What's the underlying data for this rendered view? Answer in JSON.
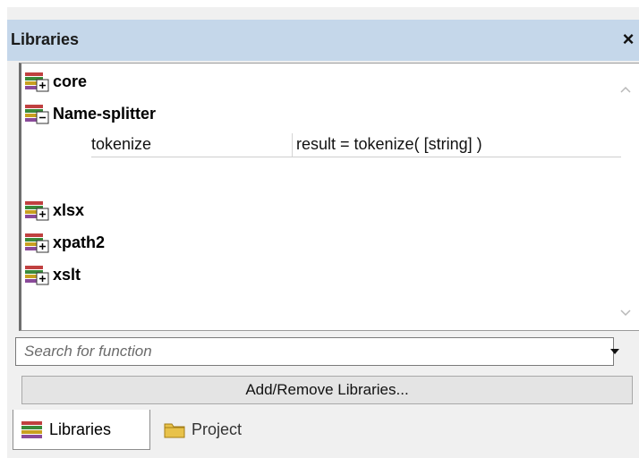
{
  "panel": {
    "title": "Libraries",
    "close_glyph": "×",
    "close_icon": "close-icon"
  },
  "tree": {
    "libraries": [
      {
        "name": "core",
        "state": "collapsed",
        "icon": "library-expand-icon"
      },
      {
        "name": "Name-splitter",
        "state": "expanded",
        "icon": "library-collapse-icon"
      },
      {
        "name": "xlsx",
        "state": "collapsed",
        "icon": "library-expand-icon"
      },
      {
        "name": "xpath2",
        "state": "collapsed",
        "icon": "library-expand-icon"
      },
      {
        "name": "xslt",
        "state": "collapsed",
        "icon": "library-expand-icon"
      }
    ],
    "functions": [
      {
        "name": "tokenize",
        "signature": "result = tokenize( [string] )"
      }
    ]
  },
  "search": {
    "placeholder": "Search for function",
    "value": ""
  },
  "add_remove_label": "Add/Remove Libraries...",
  "tabs": [
    {
      "label": "Libraries",
      "active": true,
      "icon": "libraries-tab-icon"
    },
    {
      "label": "Project",
      "active": false,
      "icon": "folder-icon"
    }
  ],
  "colors": {
    "titlebar_bg": "#c5d7ea",
    "panel_bg": "#f0f0f0",
    "tree_bg": "#ffffff"
  }
}
